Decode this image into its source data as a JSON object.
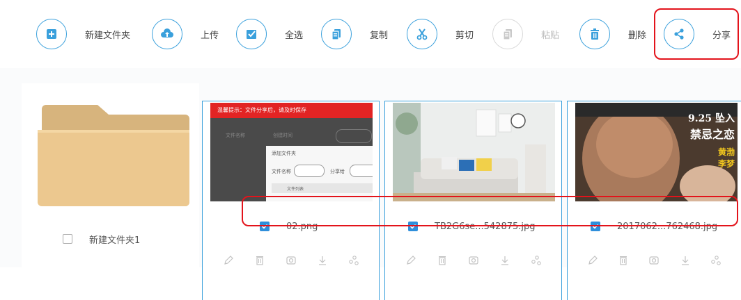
{
  "toolbar": {
    "new_folder": "新建文件夹",
    "upload": "上传",
    "select_all": "全选",
    "copy": "复制",
    "cut": "剪切",
    "paste": "粘贴",
    "delete": "删除",
    "share": "分享"
  },
  "colors": {
    "accent": "#3aa0dc",
    "highlight": "#e3131b",
    "checked": "#2f8fdb"
  },
  "items": [
    {
      "name": "新建文件夹1",
      "type": "folder",
      "checked": false
    },
    {
      "name": "02.png",
      "type": "image",
      "checked": true
    },
    {
      "name": "TB2G6se...542875.jpg",
      "type": "image",
      "checked": true
    },
    {
      "name": "2017062...762468.jpg",
      "type": "image",
      "checked": true
    }
  ],
  "thumb_02": {
    "bar_text": "温馨提示：文件分享后，请及时保存",
    "field1": "文件名称",
    "field2": "创建时间",
    "dialog_title": "添加文件夹",
    "dialog_field1": "文件名称",
    "dialog_field2": "分享给",
    "dialog_row": "文件列表"
  },
  "poster_text": {
    "line1": "9.25 坠入",
    "line2": "禁忌之恋",
    "line3": "黄渤",
    "line4": "李梦"
  },
  "icons": [
    "folder-plus-icon",
    "upload-icon",
    "checkbox-icon",
    "copy-icon",
    "scissors-icon",
    "paste-icon",
    "trash-icon",
    "share-icon",
    "edit-icon",
    "delete-icon",
    "preview-icon",
    "download-icon",
    "share-link-icon"
  ]
}
